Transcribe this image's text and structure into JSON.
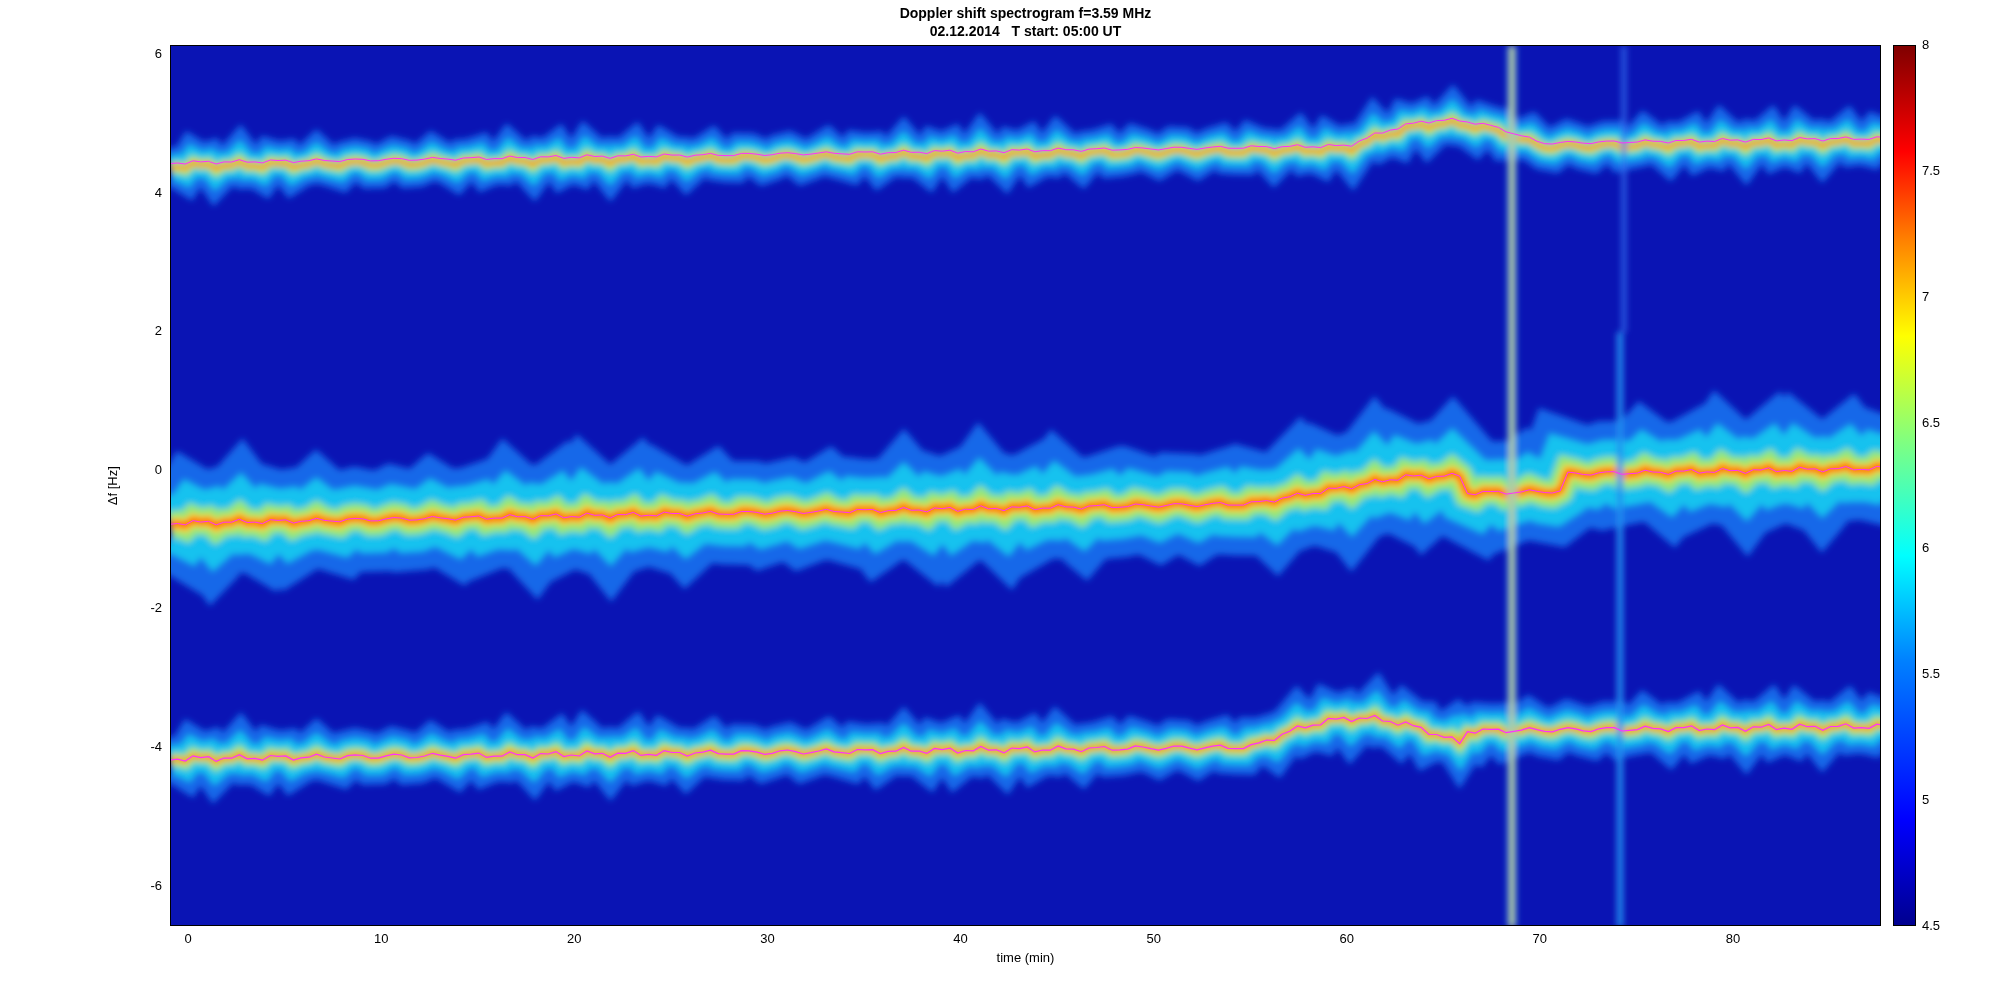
{
  "title": "Doppler shift spectrogram f=3.59 MHz",
  "subtitle": "02.12.2014   T start: 05:00 UT",
  "ylabel": "Δf [Hz]",
  "xlabel": "time (min)",
  "yticks": [
    "6",
    "4",
    "2",
    "0",
    "-2",
    "-4",
    "-6"
  ],
  "xticks": [
    "0",
    "10",
    "20",
    "30",
    "40",
    "50",
    "60",
    "70",
    "80"
  ],
  "colorbar_ticks": [
    "8",
    "7.5",
    "7",
    "6.5",
    "6",
    "5.5",
    "5",
    "4.5"
  ]
}
